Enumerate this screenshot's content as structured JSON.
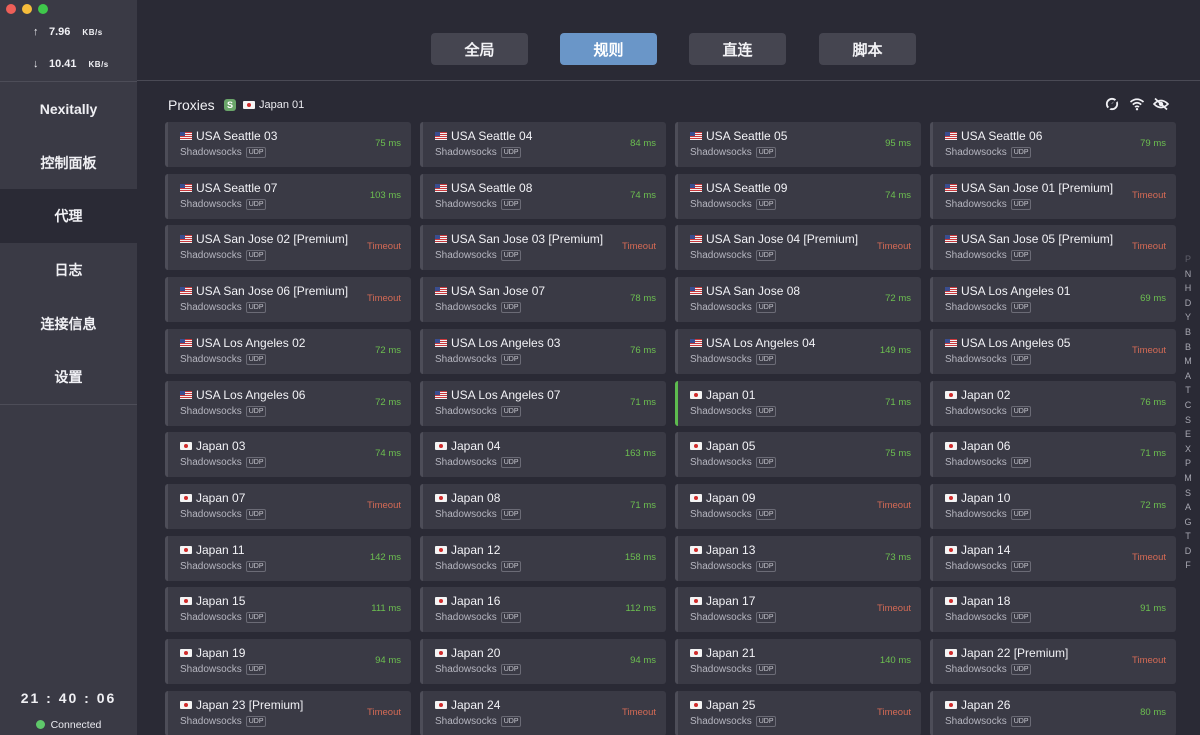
{
  "window": {
    "controls": [
      "close",
      "minimize",
      "maximize"
    ]
  },
  "traffic": {
    "up_arrow": "↑",
    "up_value": "7.96",
    "up_unit": "KB/s",
    "down_arrow": "↓",
    "down_value": "10.41",
    "down_unit": "KB/s"
  },
  "sidebar": {
    "items": [
      {
        "label": "Nexitally"
      },
      {
        "label": "控制面板"
      },
      {
        "label": "代理"
      },
      {
        "label": "日志"
      },
      {
        "label": "连接信息"
      },
      {
        "label": "设置"
      }
    ],
    "active_index": 2,
    "clock": "21 : 40 : 06",
    "status": "Connected",
    "status_color": "#5fc86a"
  },
  "mode_tabs": [
    {
      "label": "全局",
      "active": false
    },
    {
      "label": "规则",
      "active": true
    },
    {
      "label": "直连",
      "active": false
    },
    {
      "label": "脚本",
      "active": false
    }
  ],
  "proxies": {
    "title": "Proxies",
    "group_badge": "S",
    "selected": "Japan 01",
    "selected_flag": "jp",
    "header_icons": [
      "latency-test-icon",
      "wifi-icon",
      "hide-icon"
    ],
    "items": [
      {
        "name": "USA Seattle 03",
        "flag": "us",
        "type": "Shadowsocks",
        "udp": "UDP",
        "latency": "75 ms",
        "timeout": false
      },
      {
        "name": "USA Seattle 04",
        "flag": "us",
        "type": "Shadowsocks",
        "udp": "UDP",
        "latency": "84 ms",
        "timeout": false
      },
      {
        "name": "USA Seattle 05",
        "flag": "us",
        "type": "Shadowsocks",
        "udp": "UDP",
        "latency": "95 ms",
        "timeout": false
      },
      {
        "name": "USA Seattle 06",
        "flag": "us",
        "type": "Shadowsocks",
        "udp": "UDP",
        "latency": "79 ms",
        "timeout": false
      },
      {
        "name": "USA Seattle 07",
        "flag": "us",
        "type": "Shadowsocks",
        "udp": "UDP",
        "latency": "103 ms",
        "timeout": false
      },
      {
        "name": "USA Seattle 08",
        "flag": "us",
        "type": "Shadowsocks",
        "udp": "UDP",
        "latency": "74 ms",
        "timeout": false
      },
      {
        "name": "USA Seattle 09",
        "flag": "us",
        "type": "Shadowsocks",
        "udp": "UDP",
        "latency": "74 ms",
        "timeout": false
      },
      {
        "name": "USA San Jose 01 [Premium]",
        "flag": "us",
        "type": "Shadowsocks",
        "udp": "UDP",
        "latency": "Timeout",
        "timeout": true
      },
      {
        "name": "USA San Jose 02 [Premium]",
        "flag": "us",
        "type": "Shadowsocks",
        "udp": "UDP",
        "latency": "Timeout",
        "timeout": true
      },
      {
        "name": "USA San Jose 03 [Premium]",
        "flag": "us",
        "type": "Shadowsocks",
        "udp": "UDP",
        "latency": "Timeout",
        "timeout": true
      },
      {
        "name": "USA San Jose 04 [Premium]",
        "flag": "us",
        "type": "Shadowsocks",
        "udp": "UDP",
        "latency": "Timeout",
        "timeout": true
      },
      {
        "name": "USA San Jose 05 [Premium]",
        "flag": "us",
        "type": "Shadowsocks",
        "udp": "UDP",
        "latency": "Timeout",
        "timeout": true
      },
      {
        "name": "USA San Jose 06 [Premium]",
        "flag": "us",
        "type": "Shadowsocks",
        "udp": "UDP",
        "latency": "Timeout",
        "timeout": true
      },
      {
        "name": "USA San Jose 07",
        "flag": "us",
        "type": "Shadowsocks",
        "udp": "UDP",
        "latency": "78 ms",
        "timeout": false
      },
      {
        "name": "USA San Jose 08",
        "flag": "us",
        "type": "Shadowsocks",
        "udp": "UDP",
        "latency": "72 ms",
        "timeout": false
      },
      {
        "name": "USA Los Angeles 01",
        "flag": "us",
        "type": "Shadowsocks",
        "udp": "UDP",
        "latency": "69 ms",
        "timeout": false
      },
      {
        "name": "USA Los Angeles 02",
        "flag": "us",
        "type": "Shadowsocks",
        "udp": "UDP",
        "latency": "72 ms",
        "timeout": false
      },
      {
        "name": "USA Los Angeles 03",
        "flag": "us",
        "type": "Shadowsocks",
        "udp": "UDP",
        "latency": "76 ms",
        "timeout": false
      },
      {
        "name": "USA Los Angeles 04",
        "flag": "us",
        "type": "Shadowsocks",
        "udp": "UDP",
        "latency": "149 ms",
        "timeout": false
      },
      {
        "name": "USA Los Angeles 05",
        "flag": "us",
        "type": "Shadowsocks",
        "udp": "UDP",
        "latency": "Timeout",
        "timeout": true
      },
      {
        "name": "USA Los Angeles 06",
        "flag": "us",
        "type": "Shadowsocks",
        "udp": "UDP",
        "latency": "72 ms",
        "timeout": false
      },
      {
        "name": "USA Los Angeles 07",
        "flag": "us",
        "type": "Shadowsocks",
        "udp": "UDP",
        "latency": "71 ms",
        "timeout": false
      },
      {
        "name": "Japan 01",
        "flag": "jp",
        "type": "Shadowsocks",
        "udp": "UDP",
        "latency": "71 ms",
        "timeout": false,
        "selected": true
      },
      {
        "name": "Japan 02",
        "flag": "jp",
        "type": "Shadowsocks",
        "udp": "UDP",
        "latency": "76 ms",
        "timeout": false
      },
      {
        "name": "Japan 03",
        "flag": "jp",
        "type": "Shadowsocks",
        "udp": "UDP",
        "latency": "74 ms",
        "timeout": false
      },
      {
        "name": "Japan 04",
        "flag": "jp",
        "type": "Shadowsocks",
        "udp": "UDP",
        "latency": "163 ms",
        "timeout": false
      },
      {
        "name": "Japan 05",
        "flag": "jp",
        "type": "Shadowsocks",
        "udp": "UDP",
        "latency": "75 ms",
        "timeout": false
      },
      {
        "name": "Japan 06",
        "flag": "jp",
        "type": "Shadowsocks",
        "udp": "UDP",
        "latency": "71 ms",
        "timeout": false
      },
      {
        "name": "Japan 07",
        "flag": "jp",
        "type": "Shadowsocks",
        "udp": "UDP",
        "latency": "Timeout",
        "timeout": true
      },
      {
        "name": "Japan 08",
        "flag": "jp",
        "type": "Shadowsocks",
        "udp": "UDP",
        "latency": "71 ms",
        "timeout": false
      },
      {
        "name": "Japan 09",
        "flag": "jp",
        "type": "Shadowsocks",
        "udp": "UDP",
        "latency": "Timeout",
        "timeout": true
      },
      {
        "name": "Japan 10",
        "flag": "jp",
        "type": "Shadowsocks",
        "udp": "UDP",
        "latency": "72 ms",
        "timeout": false
      },
      {
        "name": "Japan 11",
        "flag": "jp",
        "type": "Shadowsocks",
        "udp": "UDP",
        "latency": "142 ms",
        "timeout": false
      },
      {
        "name": "Japan 12",
        "flag": "jp",
        "type": "Shadowsocks",
        "udp": "UDP",
        "latency": "158 ms",
        "timeout": false
      },
      {
        "name": "Japan 13",
        "flag": "jp",
        "type": "Shadowsocks",
        "udp": "UDP",
        "latency": "73 ms",
        "timeout": false
      },
      {
        "name": "Japan 14",
        "flag": "jp",
        "type": "Shadowsocks",
        "udp": "UDP",
        "latency": "Timeout",
        "timeout": true
      },
      {
        "name": "Japan 15",
        "flag": "jp",
        "type": "Shadowsocks",
        "udp": "UDP",
        "latency": "111 ms",
        "timeout": false
      },
      {
        "name": "Japan 16",
        "flag": "jp",
        "type": "Shadowsocks",
        "udp": "UDP",
        "latency": "112 ms",
        "timeout": false
      },
      {
        "name": "Japan 17",
        "flag": "jp",
        "type": "Shadowsocks",
        "udp": "UDP",
        "latency": "Timeout",
        "timeout": true
      },
      {
        "name": "Japan 18",
        "flag": "jp",
        "type": "Shadowsocks",
        "udp": "UDP",
        "latency": "91 ms",
        "timeout": false
      },
      {
        "name": "Japan 19",
        "flag": "jp",
        "type": "Shadowsocks",
        "udp": "UDP",
        "latency": "94 ms",
        "timeout": false
      },
      {
        "name": "Japan 20",
        "flag": "jp",
        "type": "Shadowsocks",
        "udp": "UDP",
        "latency": "94 ms",
        "timeout": false
      },
      {
        "name": "Japan 21",
        "flag": "jp",
        "type": "Shadowsocks",
        "udp": "UDP",
        "latency": "140 ms",
        "timeout": false
      },
      {
        "name": "Japan 22 [Premium]",
        "flag": "jp",
        "type": "Shadowsocks",
        "udp": "UDP",
        "latency": "Timeout",
        "timeout": true
      },
      {
        "name": "Japan 23 [Premium]",
        "flag": "jp",
        "type": "Shadowsocks",
        "udp": "UDP",
        "latency": "Timeout",
        "timeout": true
      },
      {
        "name": "Japan 24",
        "flag": "jp",
        "type": "Shadowsocks",
        "udp": "UDP",
        "latency": "Timeout",
        "timeout": true
      },
      {
        "name": "Japan 25",
        "flag": "jp",
        "type": "Shadowsocks",
        "udp": "UDP",
        "latency": "Timeout",
        "timeout": true
      },
      {
        "name": "Japan 26",
        "flag": "jp",
        "type": "Shadowsocks",
        "udp": "UDP",
        "latency": "80 ms",
        "timeout": false
      }
    ]
  },
  "alphabet_index": [
    "P",
    "N",
    "H",
    "D",
    "Y",
    "B",
    "B",
    "M",
    "A",
    "T",
    "C",
    "S",
    "E",
    "X",
    "P",
    "M",
    "S",
    "A",
    "G",
    "T",
    "D",
    "F"
  ],
  "colors": {
    "accent": "#6a96c8",
    "latency_ok": "#6cbf50",
    "latency_timeout": "#d46a55",
    "selected_marker": "#5dbb4f"
  }
}
